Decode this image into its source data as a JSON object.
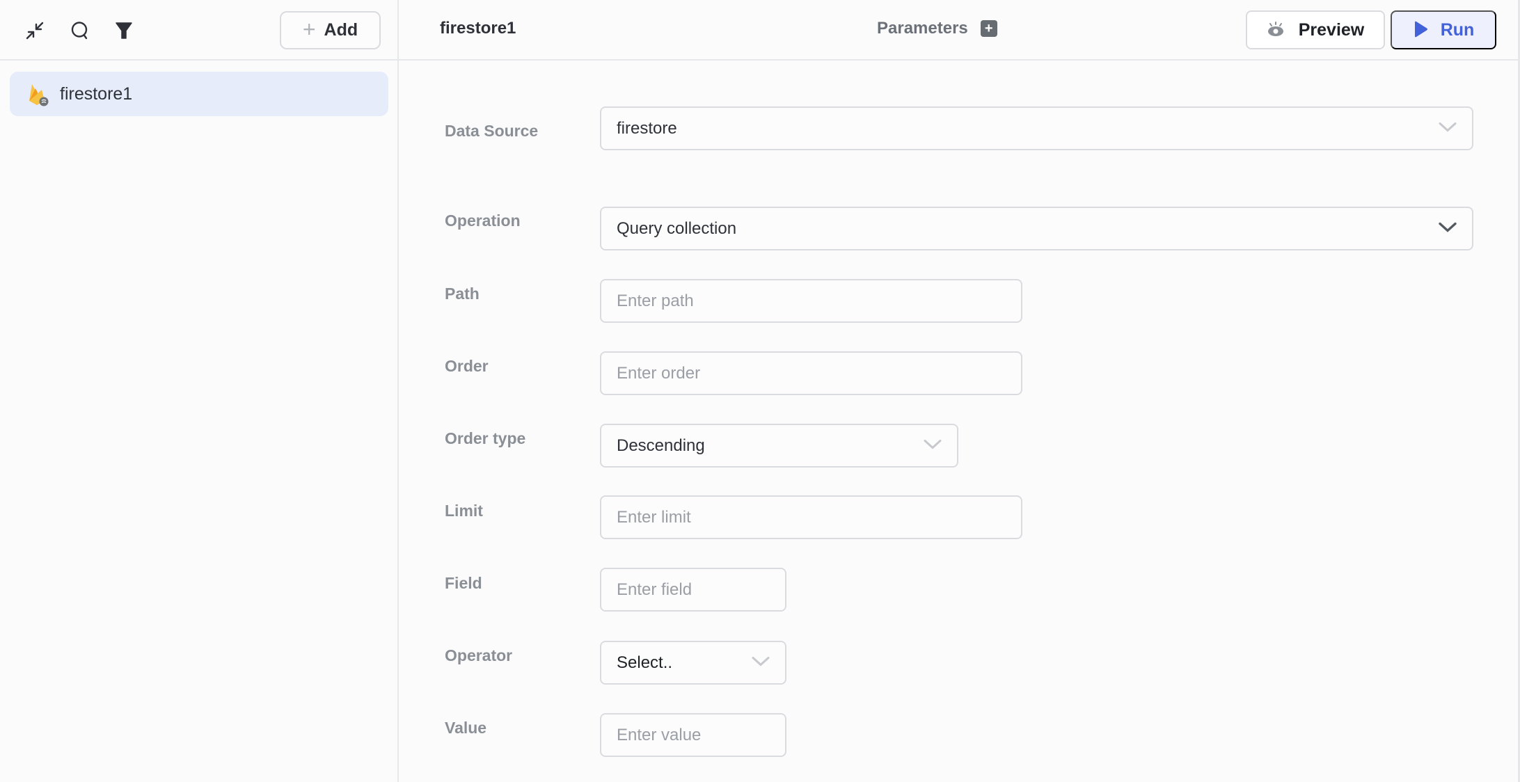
{
  "sidebar": {
    "toolbar": {
      "collapse_icon": "collapse-arrows-icon",
      "search_icon": "search-icon",
      "filter_icon": "filter-icon",
      "add_label": "Add",
      "add_icon": "plus-icon"
    },
    "queries": [
      {
        "label": "firestore1",
        "icon": "firebase-icon",
        "selected": true
      }
    ]
  },
  "header": {
    "query_name": "firestore1",
    "parameters_label": "Parameters",
    "parameters_add_icon": "plus-square-icon",
    "preview_label": "Preview",
    "preview_icon": "eye-icon",
    "run_label": "Run",
    "run_icon": "play-icon"
  },
  "colors": {
    "accent": "#4361d8",
    "selected_item_bg": "#e7ecfb",
    "run_bg": "#eef1fd",
    "label_gray": "#8a8f96",
    "border": "#d9dbdf"
  },
  "form": {
    "data_source": {
      "label": "Data Source",
      "value": "firestore"
    },
    "operation": {
      "label": "Operation",
      "value": "Query collection"
    },
    "path": {
      "label": "Path",
      "value": "",
      "placeholder": "Enter path"
    },
    "order": {
      "label": "Order",
      "value": "",
      "placeholder": "Enter order"
    },
    "order_type": {
      "label": "Order type",
      "value": "Descending"
    },
    "limit": {
      "label": "Limit",
      "value": "",
      "placeholder": "Enter limit"
    },
    "field": {
      "label": "Field",
      "value": "",
      "placeholder": "Enter field"
    },
    "operator": {
      "label": "Operator",
      "value": "Select.."
    },
    "value": {
      "label": "Value",
      "value": "",
      "placeholder": "Enter value"
    }
  }
}
